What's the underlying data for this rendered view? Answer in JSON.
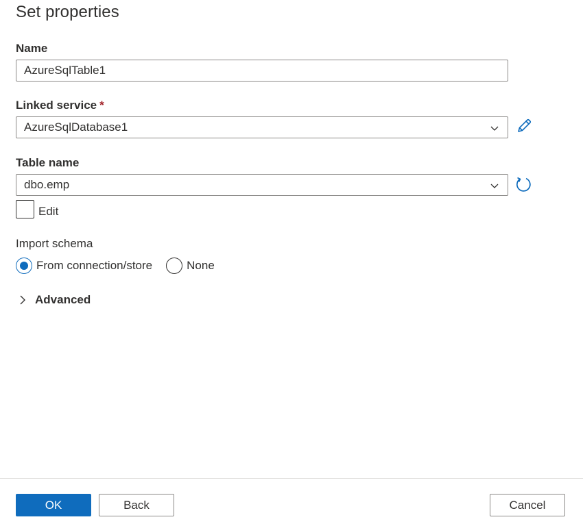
{
  "title": "Set properties",
  "name_field": {
    "label": "Name",
    "value": "AzureSqlTable1"
  },
  "linked_service": {
    "label": "Linked service",
    "required_mark": "*",
    "value": "AzureSqlDatabase1"
  },
  "table_name": {
    "label": "Table name",
    "value": "dbo.emp",
    "edit_label": "Edit",
    "edit_checked": false
  },
  "import_schema": {
    "label": "Import schema",
    "options": [
      "From connection/store",
      "None"
    ],
    "selected": "From connection/store"
  },
  "advanced": {
    "label": "Advanced"
  },
  "footer": {
    "ok_label": "OK",
    "back_label": "Back",
    "cancel_label": "Cancel"
  },
  "colors": {
    "accent": "#0f6cbd",
    "text": "#323130",
    "required": "#a4262c",
    "border": "#8a8886"
  },
  "icons": {
    "edit": "pencil-icon",
    "refresh": "refresh-icon",
    "dropdown": "chevron-down-icon",
    "expand": "chevron-right-icon"
  }
}
